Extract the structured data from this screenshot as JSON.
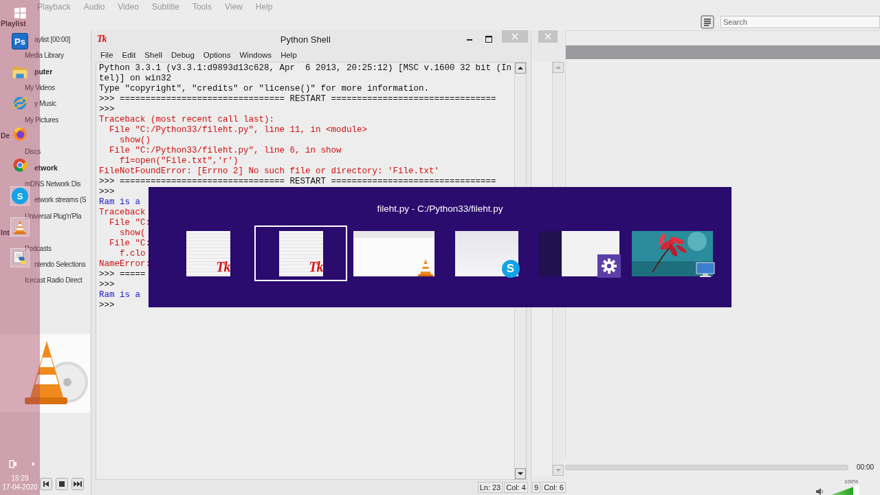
{
  "vlc": {
    "menu": [
      "Playback",
      "Audio",
      "Video",
      "Subtitle",
      "Tools",
      "View",
      "Help"
    ],
    "search": {
      "placeholder": "Search"
    },
    "sidebar": [
      {
        "kind": "header",
        "text": "Playlist",
        "behind_icon": false
      },
      {
        "kind": "item",
        "text": "aylist [00:00]",
        "behind_icon": true
      },
      {
        "kind": "item",
        "text": "Media Library",
        "behind_icon": false
      },
      {
        "kind": "header",
        "text": "puter",
        "behind_icon": true
      },
      {
        "kind": "item",
        "text": "My Videos",
        "behind_icon": false
      },
      {
        "kind": "item",
        "text": "y Music",
        "behind_icon": true
      },
      {
        "kind": "item",
        "text": "My Pictures",
        "behind_icon": false
      },
      {
        "kind": "header",
        "text": "De",
        "behind_icon": false
      },
      {
        "kind": "item",
        "text": "Discs",
        "behind_icon": false
      },
      {
        "kind": "header",
        "text": "etwork",
        "behind_icon": true
      },
      {
        "kind": "item",
        "text": "mDNS Network Dis",
        "behind_icon": false
      },
      {
        "kind": "item",
        "text": "etwork streams (S",
        "behind_icon": true
      },
      {
        "kind": "item",
        "text": "Universal Plug'n'Pla",
        "behind_icon": false
      },
      {
        "kind": "header",
        "text": "Int",
        "behind_icon": false
      },
      {
        "kind": "item",
        "text": "Podcasts",
        "behind_icon": false
      },
      {
        "kind": "item",
        "text": "ntendo Selections",
        "behind_icon": true
      },
      {
        "kind": "item",
        "text": "Icecast Radio Direct",
        "behind_icon": false
      }
    ],
    "time": "00:00",
    "volume": {
      "reading": "100%",
      "level": 0.8
    }
  },
  "python_shell": {
    "title": "Python Shell",
    "logo": "Tk",
    "menu": [
      "File",
      "Edit",
      "Shell",
      "Debug",
      "Options",
      "Windows",
      "Help"
    ],
    "lines": [
      {
        "kind": "output",
        "text": "Python 3.3.1 (v3.3.1:d9893d13c628, Apr  6 2013, 20:25:12) [MSC v.1600 32 bit (In"
      },
      {
        "kind": "output",
        "text": "tel)] on win32"
      },
      {
        "kind": "output",
        "text": "Type \"copyright\", \"credits\" or \"license()\" for more information."
      },
      {
        "kind": "output",
        "text": ">>> ================================ RESTART ================================"
      },
      {
        "kind": "output",
        "text": ">>>"
      },
      {
        "kind": "error",
        "text": "Traceback (most recent call last):"
      },
      {
        "kind": "error",
        "text": "  File \"C:/Python33/fileht.py\", line 11, in <module>"
      },
      {
        "kind": "error",
        "text": "    show()"
      },
      {
        "kind": "error",
        "text": "  File \"C:/Python33/fileht.py\", line 6, in show"
      },
      {
        "kind": "error",
        "text": "    f1=open(\"File.txt\",'r')"
      },
      {
        "kind": "error",
        "text": "FileNotFoundError: [Errno 2] No such file or directory: 'File.txt'"
      },
      {
        "kind": "output",
        "text": ">>> ================================ RESTART ================================"
      },
      {
        "kind": "output",
        "text": ">>>"
      },
      {
        "kind": "stdout",
        "text": "Ram is a"
      },
      {
        "kind": "error",
        "text": "Traceback"
      },
      {
        "kind": "error",
        "text": "  File \"C:"
      },
      {
        "kind": "error",
        "text": "    show("
      },
      {
        "kind": "error",
        "text": "  File \"C:"
      },
      {
        "kind": "error",
        "text": "    f.clo"
      },
      {
        "kind": "error",
        "text": "NameError:"
      },
      {
        "kind": "output",
        "text": ">>> ====="
      },
      {
        "kind": "output",
        "text": ">>>"
      },
      {
        "kind": "stdout",
        "text": "Ram is a"
      },
      {
        "kind": "output",
        "text": ">>>"
      }
    ],
    "status": {
      "line": "Ln: 23",
      "col": "Col: 4"
    }
  },
  "second_window": {
    "status": [
      "9",
      "Col: 6"
    ]
  },
  "switcher": {
    "title": "fileht.py - C:/Python33/fileht.py",
    "items": [
      {
        "kind": "idle",
        "badge": "Tk",
        "selected": false
      },
      {
        "kind": "idle",
        "badge": "Tk",
        "selected": true
      },
      {
        "kind": "vlc",
        "selected": false
      },
      {
        "kind": "skype",
        "badge": "S",
        "selected": false
      },
      {
        "kind": "settings",
        "selected": false
      },
      {
        "kind": "desktop",
        "selected": false
      }
    ]
  },
  "taskbar": {
    "items": [
      {
        "kind": "start",
        "highlighted": false
      },
      {
        "kind": "photoshop",
        "text": "Ps",
        "highlighted": false
      },
      {
        "kind": "folder",
        "highlighted": false
      },
      {
        "kind": "ie",
        "highlighted": false
      },
      {
        "kind": "firefox",
        "highlighted": false
      },
      {
        "kind": "chrome",
        "highlighted": false
      },
      {
        "kind": "skype",
        "text": "S",
        "highlighted": true
      },
      {
        "kind": "vlc",
        "highlighted": true
      },
      {
        "kind": "python",
        "highlighted": true
      }
    ],
    "clock": {
      "time": "15:29",
      "date": "17-04-2020"
    }
  }
}
